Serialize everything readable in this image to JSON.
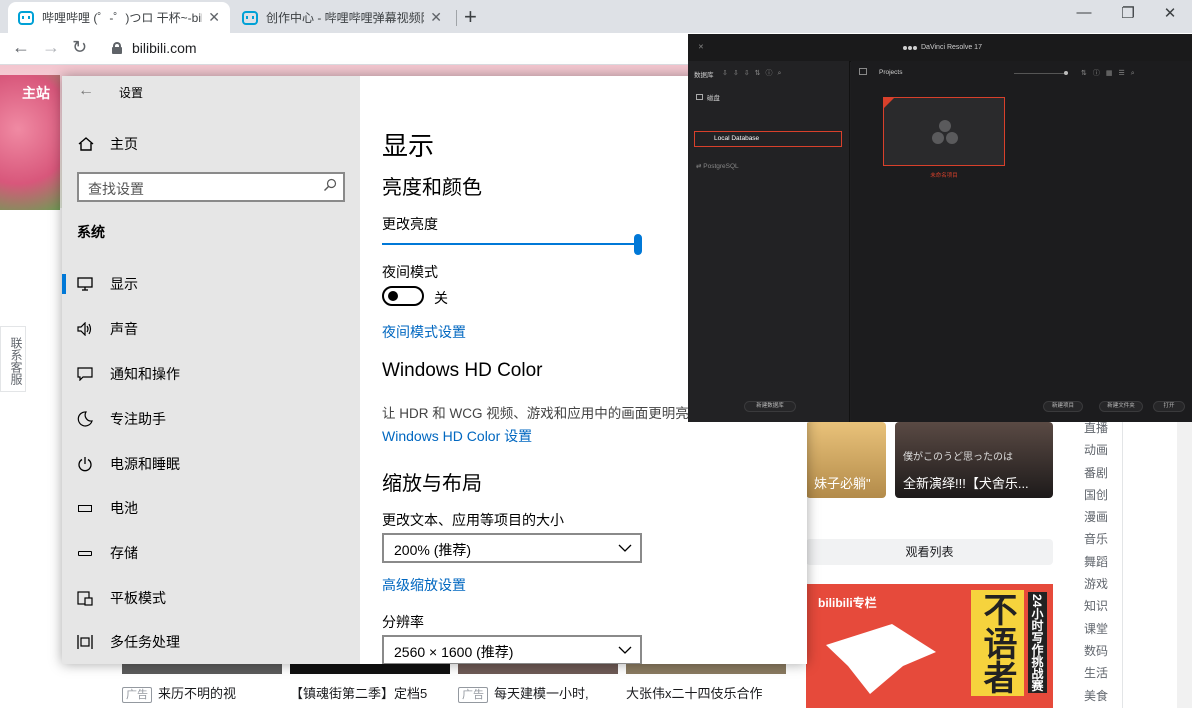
{
  "browser": {
    "tabs": [
      {
        "title": "哔哩哔哩 (゜-゜)つロ 干杯~-bilibili",
        "active": true
      },
      {
        "title": "创作中心 - 哔哩哔哩弹幕视频网",
        "active": false
      }
    ],
    "new_tab": "+",
    "url": "bilibili.com",
    "minimize": "—",
    "restore": "❐",
    "close": "✕",
    "back": "←",
    "forward": "→",
    "reload": "↻"
  },
  "bilibili": {
    "header_label": "主站",
    "contact": "联系客服",
    "thumbs": [
      {
        "caption": "妹子必躺\""
      },
      {
        "caption": "全新演绎!!!【犬舍乐..."
      }
    ],
    "thumb_overlay": "僕がこのうど思ったのは",
    "watch_list": "观看列表",
    "ad_logo": "bilibili专栏",
    "ad_big": "不语者",
    "ad_vertical": "24小时写作挑战赛",
    "categories": [
      "直播",
      "动画",
      "番剧",
      "国创",
      "漫画",
      "音乐",
      "舞蹈",
      "游戏",
      "知识",
      "课堂",
      "数码",
      "生活",
      "美食"
    ],
    "videos": [
      {
        "ad": "广告",
        "title": "来历不明的视"
      },
      {
        "ad": "",
        "title": "【镇魂街第二季】定档5"
      },
      {
        "ad": "广告",
        "title": "每天建模一小时,"
      },
      {
        "ad": "",
        "title": "大张伟x二十四伎乐合作"
      }
    ]
  },
  "settings": {
    "window_title": "设置",
    "home": "主页",
    "search_placeholder": "查找设置",
    "section": "系统",
    "nav": [
      {
        "label": "显示",
        "icon": "monitor-icon",
        "selected": true
      },
      {
        "label": "声音",
        "icon": "speaker-icon",
        "selected": false
      },
      {
        "label": "通知和操作",
        "icon": "message-icon",
        "selected": false
      },
      {
        "label": "专注助手",
        "icon": "moon-icon",
        "selected": false
      },
      {
        "label": "电源和睡眠",
        "icon": "power-icon",
        "selected": false
      },
      {
        "label": "电池",
        "icon": "battery-icon",
        "selected": false
      },
      {
        "label": "存储",
        "icon": "storage-icon",
        "selected": false
      },
      {
        "label": "平板模式",
        "icon": "tablet-icon",
        "selected": false
      },
      {
        "label": "多任务处理",
        "icon": "multitask-icon",
        "selected": false
      }
    ],
    "main": {
      "title": "显示",
      "brightness_heading": "亮度和颜色",
      "brightness_label": "更改亮度",
      "brightness_value": 100,
      "night_mode_label": "夜间模式",
      "night_mode_state": "关",
      "night_mode_link": "夜间模式设置",
      "hdr_heading": "Windows HD Color",
      "hdr_desc": "让 HDR 和 WCG 视频、游戏和应用中的画面更明亮、更生动。",
      "hdr_link": "Windows HD Color 设置",
      "scale_heading": "缩放与布局",
      "scale_label": "更改文本、应用等项目的大小",
      "scale_value": "200% (推荐)",
      "scale_link": "高级缩放设置",
      "resolution_label": "分辨率",
      "resolution_value": "2560 × 1600 (推荐)"
    }
  },
  "resolve": {
    "title": "DaVinci Resolve 17",
    "close": "✕",
    "left_header": "数据库",
    "left_icons": "⇩⇩⇩⇅ⓘ⌕",
    "disk_section": "磁盘",
    "local_db": "Local Database",
    "postgres": "PostgreSQL",
    "new_db_button": "新建数据库",
    "projects_header": "Projects",
    "right_icons": "⇅ⓘ▦☰⌕",
    "project_name": "未命名项目",
    "buttons": {
      "new_project": "新建项目",
      "new_folder": "新建文件夹",
      "open": "打开"
    },
    "accent": "#d8402b"
  }
}
